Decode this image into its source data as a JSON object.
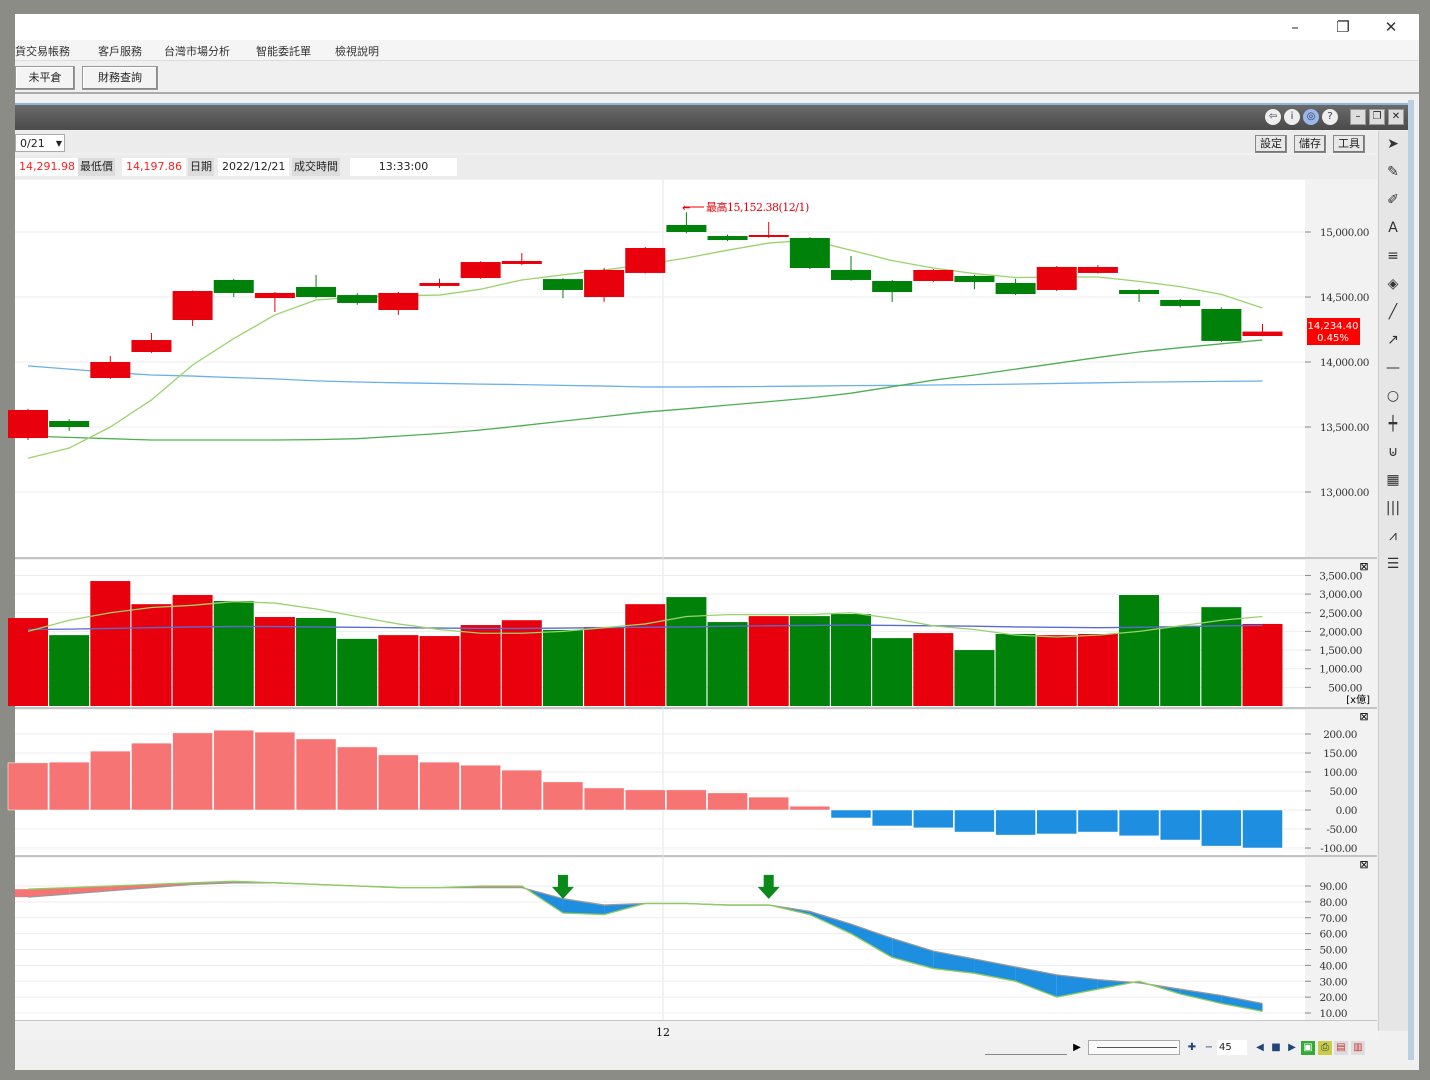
{
  "window": {
    "minimize": "–",
    "maximize": "❐",
    "close": "✕"
  },
  "menu": [
    "貨交易帳務",
    "客戶服務",
    "台灣市場分析",
    "智能委託單",
    "檢視說明"
  ],
  "toolbar": {
    "buttons": [
      "未平倉",
      "財務查詢"
    ]
  },
  "panel_icons": [
    "⇦",
    "i",
    "◎",
    "?"
  ],
  "panel_controls": [
    "–",
    "❐",
    "✕"
  ],
  "controls": {
    "date_select": "0/21",
    "settings": "設定",
    "save": "儲存",
    "tools": "工具"
  },
  "quote": {
    "high_value": "14,291.98",
    "low_label": "最低價",
    "low_value": "14,197.86",
    "date_label": "日期",
    "date_value": "2022/12/21",
    "time_label": "成交時間",
    "time_value": "13:33:00"
  },
  "side_tools": [
    "pointer-icon",
    "eraser-one-icon",
    "eraser-all-icon",
    "text-icon",
    "lines-icon",
    "paint-icon",
    "line-icon",
    "arrow-icon",
    "hline-icon",
    "circle-icon",
    "candle-icon",
    "magnet-icon",
    "chart-icon",
    "vbars-icon",
    "fan-icon",
    "list-icon"
  ],
  "bottom": {
    "zoom_value": "45"
  },
  "colors": {
    "up": "#e8000c",
    "down": "#00820a",
    "ma_short": "#9ad36a",
    "ma_mid": "#4caf50",
    "ma_long": "#6ab0ea",
    "macd_pos": "#f77474",
    "macd_neg": "#1e8ee0",
    "k_line": "#8ccd5c",
    "d_line": "#999999"
  },
  "chart_data": [
    {
      "type": "candlestick",
      "panel": "price",
      "yticks": [
        "15,000.00",
        "14,500.00",
        "14,000.00",
        "13,500.00",
        "13,000.00"
      ],
      "ylim": [
        12700,
        15400
      ],
      "xtick_labels": [
        "12"
      ],
      "annotation": "最高15,152.38(12/1)",
      "last_price": "14,234.40",
      "last_change": "0.45%",
      "candles": [
        {
          "o": 13415,
          "c": 13631,
          "h": 13640,
          "l": 13400
        },
        {
          "o": 13546,
          "c": 13500,
          "h": 13560,
          "l": 13470
        },
        {
          "o": 13877,
          "c": 14000,
          "h": 14046,
          "l": 13870
        },
        {
          "o": 14077,
          "c": 14169,
          "h": 14223,
          "l": 14070
        },
        {
          "o": 14323,
          "c": 14546,
          "h": 14550,
          "l": 14277
        },
        {
          "o": 14631,
          "c": 14531,
          "h": 14640,
          "l": 14500
        },
        {
          "o": 14492,
          "c": 14531,
          "h": 14540,
          "l": 14385
        },
        {
          "o": 14577,
          "c": 14500,
          "h": 14669,
          "l": 14490
        },
        {
          "o": 14515,
          "c": 14454,
          "h": 14530,
          "l": 14440
        },
        {
          "o": 14400,
          "c": 14531,
          "h": 14540,
          "l": 14362
        },
        {
          "o": 14585,
          "c": 14608,
          "h": 14640,
          "l": 14570
        },
        {
          "o": 14646,
          "c": 14769,
          "h": 14775,
          "l": 14640
        },
        {
          "o": 14754,
          "c": 14777,
          "h": 14838,
          "l": 14745
        },
        {
          "o": 14638,
          "c": 14554,
          "h": 14645,
          "l": 14492
        },
        {
          "o": 14500,
          "c": 14708,
          "h": 14723,
          "l": 14462
        },
        {
          "o": 14685,
          "c": 14877,
          "h": 14885,
          "l": 14680
        },
        {
          "o": 15054,
          "c": 15000,
          "h": 15152,
          "l": 14990
        },
        {
          "o": 14969,
          "c": 14938,
          "h": 14980,
          "l": 14930
        },
        {
          "o": 14962,
          "c": 14977,
          "h": 15077,
          "l": 14955
        },
        {
          "o": 14954,
          "c": 14723,
          "h": 14960,
          "l": 14715
        },
        {
          "o": 14708,
          "c": 14631,
          "h": 14815,
          "l": 14625
        },
        {
          "o": 14623,
          "c": 14538,
          "h": 14630,
          "l": 14462
        },
        {
          "o": 14623,
          "c": 14708,
          "h": 14715,
          "l": 14615
        },
        {
          "o": 14662,
          "c": 14615,
          "h": 14670,
          "l": 14560
        },
        {
          "o": 14608,
          "c": 14523,
          "h": 14640,
          "l": 14515
        },
        {
          "o": 14554,
          "c": 14731,
          "h": 14738,
          "l": 14545
        },
        {
          "o": 14685,
          "c": 14731,
          "h": 14745,
          "l": 14680
        },
        {
          "o": 14554,
          "c": 14523,
          "h": 14562,
          "l": 14462
        },
        {
          "o": 14477,
          "c": 14431,
          "h": 14485,
          "l": 14420
        },
        {
          "o": 14408,
          "c": 14162,
          "h": 14420,
          "l": 14155
        },
        {
          "o": 14200,
          "c": 14234,
          "h": 14292,
          "l": 14198
        }
      ],
      "ma_short": [
        13260,
        13338,
        13500,
        13708,
        13977,
        14180,
        14362,
        14477,
        14500,
        14510,
        14515,
        14560,
        14631,
        14670,
        14708,
        14750,
        14800,
        14860,
        14915,
        14938,
        14860,
        14780,
        14723,
        14680,
        14650,
        14654,
        14654,
        14620,
        14580,
        14520,
        14415
      ],
      "ma_mid": [
        13430,
        13420,
        13410,
        13400,
        13400,
        13400,
        13400,
        13403,
        13410,
        13430,
        13450,
        13477,
        13510,
        13545,
        13580,
        13615,
        13640,
        13668,
        13695,
        13723,
        13760,
        13810,
        13860,
        13900,
        13945,
        13990,
        14035,
        14077,
        14110,
        14140,
        14169
      ],
      "ma_long": [
        13970,
        13945,
        13920,
        13900,
        13892,
        13880,
        13870,
        13855,
        13846,
        13840,
        13835,
        13830,
        13826,
        13820,
        13815,
        13808,
        13808,
        13810,
        13812,
        13815,
        13818,
        13820,
        13823,
        13826,
        13830,
        13835,
        13840,
        13845,
        13848,
        13851,
        13854
      ]
    },
    {
      "type": "bar",
      "panel": "volume",
      "unit": "[x億]",
      "yticks": [
        "3,500.00",
        "3,000.00",
        "2,500.00",
        "2,000.00",
        "1,500.00",
        "1,000.00",
        "500.00"
      ],
      "values": [
        2358,
        1900,
        3350,
        2730,
        2975,
        2815,
        2385,
        2360,
        1800,
        1900,
        1875,
        2170,
        2300,
        2040,
        2120,
        2730,
        2920,
        2250,
        2410,
        2410,
        2465,
        1820,
        1955,
        1500,
        1930,
        1900,
        1930,
        2975,
        2120,
        2650,
        2200
      ],
      "ma_short": [
        2000,
        2300,
        2500,
        2640,
        2700,
        2800,
        2760,
        2600,
        2400,
        2200,
        2050,
        1950,
        1950,
        2000,
        2100,
        2200,
        2400,
        2450,
        2450,
        2450,
        2500,
        2350,
        2150,
        2050,
        1900,
        1850,
        1900,
        2000,
        2150,
        2300,
        2400
      ],
      "ma_long": [
        2050,
        2060,
        2080,
        2100,
        2120,
        2130,
        2130,
        2120,
        2110,
        2100,
        2090,
        2080,
        2080,
        2090,
        2100,
        2110,
        2120,
        2140,
        2150,
        2160,
        2170,
        2160,
        2150,
        2140,
        2120,
        2110,
        2100,
        2110,
        2130,
        2150,
        2160
      ]
    },
    {
      "type": "bar",
      "panel": "macd",
      "yticks": [
        "200.00",
        "150.00",
        "100.00",
        "50.00",
        "0.00",
        "-50.00",
        "-100.00"
      ],
      "values": [
        124,
        126,
        155,
        176,
        203,
        210,
        205,
        187,
        166,
        145,
        126,
        118,
        105,
        74,
        58,
        53,
        53,
        45,
        34,
        10,
        -21,
        -42,
        -47,
        -58,
        -66,
        -63,
        -58,
        -68,
        -79,
        -95,
        -100
      ]
    },
    {
      "type": "line",
      "panel": "kd",
      "yticks": [
        "90.00",
        "80.00",
        "70.00",
        "60.00",
        "50.00",
        "40.00",
        "30.00",
        "20.00",
        "10.00"
      ],
      "k": [
        88,
        89,
        90,
        91,
        92,
        93,
        92,
        91,
        90,
        89,
        89,
        90,
        90,
        73,
        72,
        79,
        79,
        78,
        78,
        72,
        60,
        45,
        38,
        35,
        30,
        20,
        25,
        30,
        22,
        16,
        11
      ],
      "d": [
        83,
        85,
        87,
        89,
        91,
        92,
        92,
        91,
        90,
        89,
        89,
        89,
        89,
        82,
        78,
        79,
        79,
        78,
        78,
        74,
        66,
        57,
        49,
        44,
        39,
        34,
        31,
        29,
        25,
        21,
        16
      ],
      "signal_arrows": [
        13,
        18
      ]
    }
  ]
}
